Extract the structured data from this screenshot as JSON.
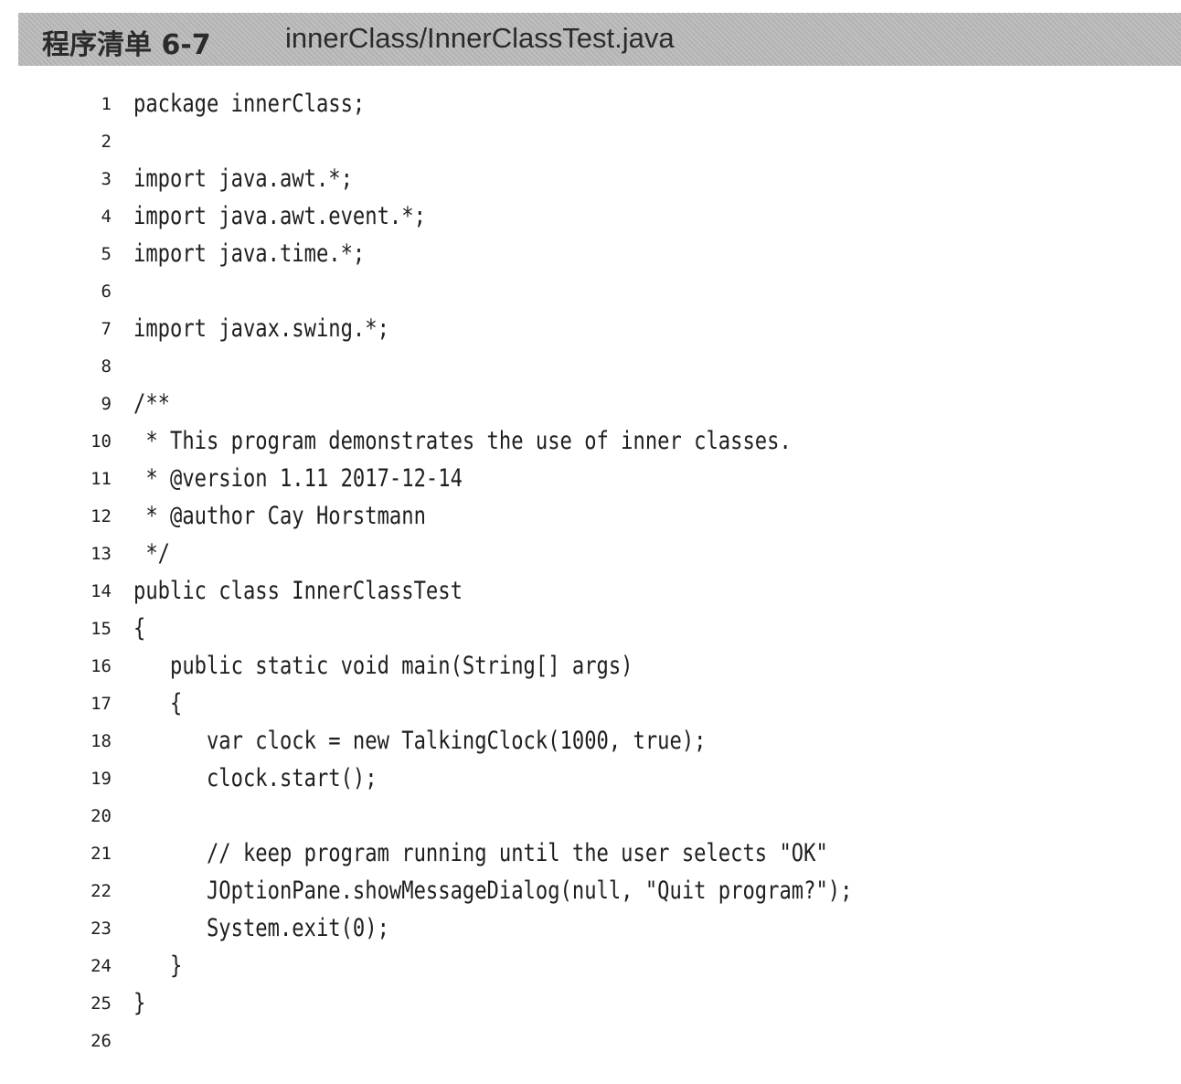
{
  "listing": {
    "label": "程序清单 6-7",
    "file": "innerClass/InnerClassTest.java"
  },
  "code": {
    "lines": [
      {
        "number": "1",
        "text": "package innerClass;"
      },
      {
        "number": "2",
        "text": ""
      },
      {
        "number": "3",
        "text": "import java.awt.*;"
      },
      {
        "number": "4",
        "text": "import java.awt.event.*;"
      },
      {
        "number": "5",
        "text": "import java.time.*;"
      },
      {
        "number": "6",
        "text": ""
      },
      {
        "number": "7",
        "text": "import javax.swing.*;"
      },
      {
        "number": "8",
        "text": ""
      },
      {
        "number": "9",
        "text": "/**"
      },
      {
        "number": "10",
        "text": " * This program demonstrates the use of inner classes."
      },
      {
        "number": "11",
        "text": " * @version 1.11 2017-12-14"
      },
      {
        "number": "12",
        "text": " * @author Cay Horstmann"
      },
      {
        "number": "13",
        "text": " */"
      },
      {
        "number": "14",
        "text": "public class InnerClassTest"
      },
      {
        "number": "15",
        "text": "{"
      },
      {
        "number": "16",
        "text": "   public static void main(String[] args)"
      },
      {
        "number": "17",
        "text": "   {"
      },
      {
        "number": "18",
        "text": "      var clock = new TalkingClock(1000, true);"
      },
      {
        "number": "19",
        "text": "      clock.start();"
      },
      {
        "number": "20",
        "text": ""
      },
      {
        "number": "21",
        "text": "      // keep program running until the user selects \"OK\""
      },
      {
        "number": "22",
        "text": "      JOptionPane.showMessageDialog(null, \"Quit program?\");"
      },
      {
        "number": "23",
        "text": "      System.exit(0);"
      },
      {
        "number": "24",
        "text": "   }"
      },
      {
        "number": "25",
        "text": "}"
      },
      {
        "number": "26",
        "text": ""
      }
    ]
  }
}
